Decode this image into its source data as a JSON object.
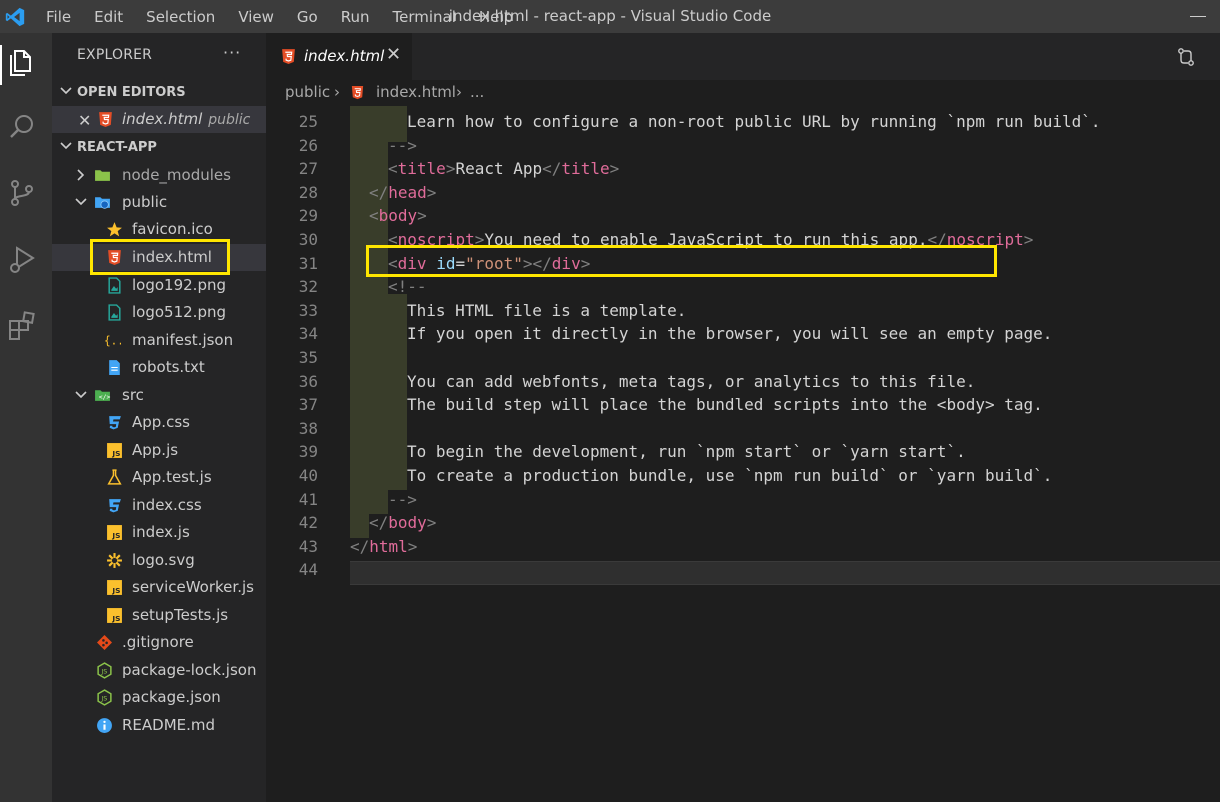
{
  "window": {
    "title": "index.html - react-app - Visual Studio Code"
  },
  "menu": [
    "File",
    "Edit",
    "Selection",
    "View",
    "Go",
    "Run",
    "Terminal",
    "Help"
  ],
  "sidebar": {
    "header": "EXPLORER",
    "more": "···",
    "open_editors_label": "OPEN EDITORS",
    "open_editor": {
      "name": "index.html",
      "folder": "public"
    },
    "project_label": "REACT-APP",
    "tree": [
      {
        "name": "node_modules",
        "kind": "folder-closed",
        "icon": "node-folder-icon"
      },
      {
        "name": "public",
        "kind": "folder-open",
        "icon": "public-folder-icon"
      },
      {
        "name": "favicon.ico",
        "kind": "file",
        "icon": "star-icon"
      },
      {
        "name": "index.html",
        "kind": "file",
        "icon": "html-icon"
      },
      {
        "name": "logo192.png",
        "kind": "file",
        "icon": "image-icon"
      },
      {
        "name": "logo512.png",
        "kind": "file",
        "icon": "image-icon"
      },
      {
        "name": "manifest.json",
        "kind": "file",
        "icon": "json-braces-icon"
      },
      {
        "name": "robots.txt",
        "kind": "file",
        "icon": "text-file-icon"
      },
      {
        "name": "src",
        "kind": "folder-open",
        "icon": "src-folder-icon"
      },
      {
        "name": "App.css",
        "kind": "file",
        "icon": "css-icon"
      },
      {
        "name": "App.js",
        "kind": "file",
        "icon": "js-icon"
      },
      {
        "name": "App.test.js",
        "kind": "file",
        "icon": "flask-icon"
      },
      {
        "name": "index.css",
        "kind": "file",
        "icon": "css-icon"
      },
      {
        "name": "index.js",
        "kind": "file",
        "icon": "js-icon"
      },
      {
        "name": "logo.svg",
        "kind": "file",
        "icon": "svg-sun-icon"
      },
      {
        "name": "serviceWorker.js",
        "kind": "file",
        "icon": "js-icon"
      },
      {
        "name": "setupTests.js",
        "kind": "file",
        "icon": "js-icon"
      },
      {
        "name": ".gitignore",
        "kind": "file",
        "icon": "git-icon"
      },
      {
        "name": "package-lock.json",
        "kind": "file",
        "icon": "nodejs-icon"
      },
      {
        "name": "package.json",
        "kind": "file",
        "icon": "nodejs-icon"
      },
      {
        "name": "README.md",
        "kind": "file",
        "icon": "info-icon"
      }
    ]
  },
  "tab": {
    "name": "index.html",
    "close": "✕"
  },
  "breadcrumb": {
    "folder": "public",
    "file": "index.html",
    "more": "..."
  },
  "editor": {
    "line_numbers": [
      "25",
      "26",
      "27",
      "28",
      "29",
      "30",
      "31",
      "32",
      "33",
      "34",
      "35",
      "36",
      "37",
      "38",
      "39",
      "40",
      "41",
      "42",
      "43",
      "44"
    ],
    "lines": {
      "l25": "Learn how to configure a non-root public URL by running `npm run build`.",
      "l26": "-->",
      "l27_open": "title",
      "l27_text": "React App",
      "l27_close": "title",
      "l28": "head",
      "l29": "body",
      "l30_tag": "noscript",
      "l30_text": "You need to enable JavaScript to run this app.",
      "l31_tag": "div",
      "l31_attr": "id",
      "l31_val": "\"root\"",
      "l32": "<!--",
      "l33": "This HTML file is a template.",
      "l34": "If you open it directly in the browser, you will see an empty page.",
      "l36": "You can add webfonts, meta tags, or analytics to this file.",
      "l37": "The build step will place the bundled scripts into the <body> tag.",
      "l39": "To begin the development, run `npm start` or `yarn start`.",
      "l40": "To create a production bundle, use `npm run build` or `yarn build`.",
      "l41": "-->",
      "l42": "body",
      "l43": "html"
    }
  },
  "colors": {
    "highlight": "#ffe600",
    "tag": "#e06c9a",
    "string": "#ce9178",
    "attribute": "#9cdcfe"
  }
}
